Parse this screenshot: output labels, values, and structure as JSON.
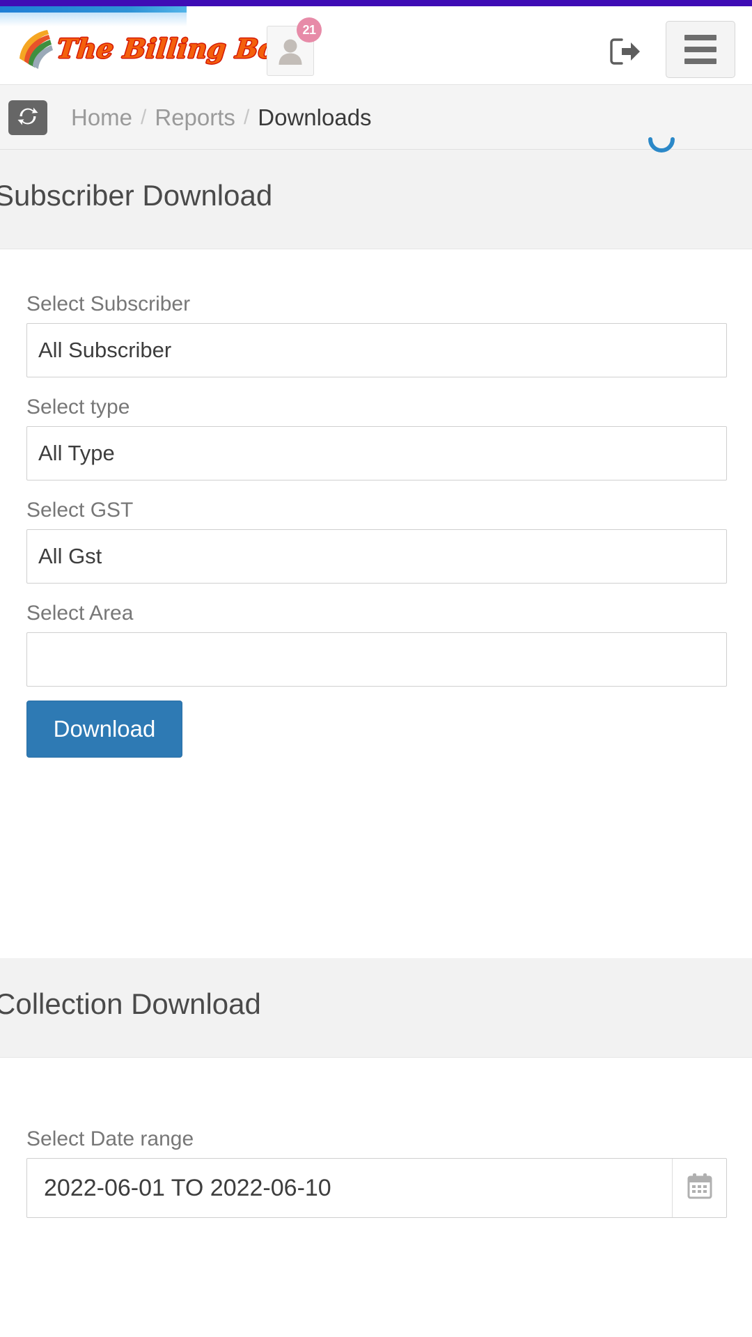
{
  "brand": {
    "wordmark": "The Billing Book",
    "logo_icon": "rainbow-swoosh-icon"
  },
  "header": {
    "avatar_icon": "user-avatar-icon",
    "notification_count": "21",
    "logout_icon": "logout-icon",
    "menu_icon": "hamburger-menu-icon"
  },
  "breadcrumb": {
    "refresh_icon": "refresh-icon",
    "items": [
      {
        "label": "Home",
        "active": false
      },
      {
        "label": "Reports",
        "active": false
      },
      {
        "label": "Downloads",
        "active": true
      }
    ],
    "separator": "/",
    "loading_icon": "loading-spinner-icon"
  },
  "subscriber_download": {
    "title": "Subscriber Download",
    "fields": [
      {
        "label": "Select Subscriber",
        "value": "All Subscriber",
        "name": "select-subscriber"
      },
      {
        "label": "Select type",
        "value": "All Type",
        "name": "select-type"
      },
      {
        "label": "Select GST",
        "value": "All Gst",
        "name": "select-gst"
      },
      {
        "label": "Select Area",
        "value": "",
        "name": "select-area"
      }
    ],
    "download_label": "Download"
  },
  "collection_download": {
    "title": "Collection Download",
    "date_range_label": "Select Date range",
    "date_range_value": "2022-06-01 TO 2022-06-10",
    "calendar_icon": "calendar-icon"
  },
  "colors": {
    "accent_purple": "#3f0cb5",
    "progress_blue": "#2f93d6",
    "primary_button": "#2e7ab4",
    "badge_pink": "#e78ba8",
    "brand_orange": "#f4600c",
    "brand_outline_red": "#d41a08",
    "spinner_blue": "#2b88c8",
    "band_gray": "#f2f2f2"
  }
}
